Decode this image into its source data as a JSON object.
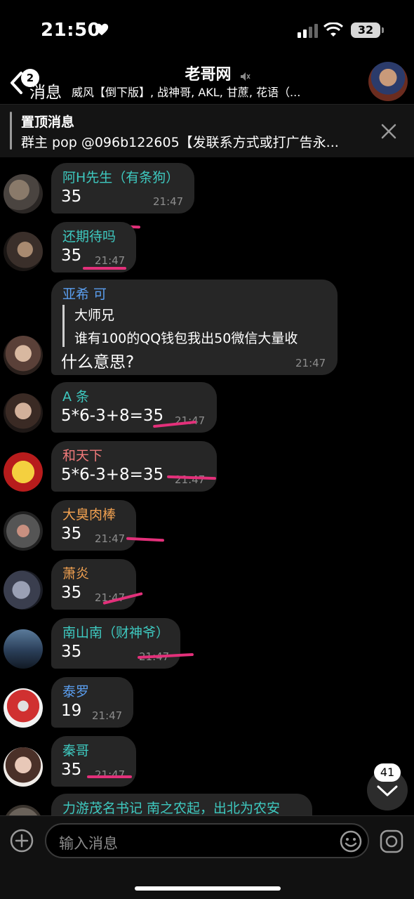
{
  "status_bar": {
    "time": "21:50",
    "battery": "32"
  },
  "header": {
    "back_badge": "2",
    "back_label": "消息",
    "title": "老哥网",
    "subtitle": "威风【倒下版】, 战神哥, AKL, 甘蔗, 花语（..."
  },
  "pinned": {
    "title": "置顶消息",
    "text": "群主 pop @096b122605【发联系方式或打广告永..."
  },
  "messages": [
    {
      "sender": "阿H先生（有条狗）",
      "sender_color": "#3ec9c0",
      "text": "35",
      "time": "21:47"
    },
    {
      "sender": "还期待吗",
      "sender_color": "#3ec9c0",
      "text": "35",
      "time": "21:47"
    },
    {
      "sender": "亚希 可",
      "sender_color": "#5b9ff0",
      "quote_name": "大师兄",
      "quote_text": "谁有100的QQ钱包我出50微信大量收",
      "text": "什么意思?",
      "time": "21:47"
    },
    {
      "sender": "A 条",
      "sender_color": "#3ec9c0",
      "text": "5*6-3+8=35",
      "time": "21:47"
    },
    {
      "sender": "和天下",
      "sender_color": "#f07a7a",
      "text": "5*6-3+8=35",
      "time": "21:47"
    },
    {
      "sender": "大臭肉棒",
      "sender_color": "#f0a050",
      "text": "35",
      "time": "21:47"
    },
    {
      "sender": "萧炎",
      "sender_color": "#f0a050",
      "text": "35",
      "time": "21:47"
    },
    {
      "sender": "南山南（财神爷）",
      "sender_color": "#3ec9c0",
      "text": "35",
      "time": "21:47"
    },
    {
      "sender": "泰罗",
      "sender_color": "#5b9ff0",
      "text": "19",
      "time": "21:47"
    },
    {
      "sender": "秦哥",
      "sender_color": "#3ec9c0",
      "text": "35",
      "time": "21:47"
    },
    {
      "sender": "力游茂名书记 南之农起，出北为农安",
      "sender_color": "#3ec9c0"
    }
  ],
  "unread_count": "41",
  "input": {
    "placeholder": "输入消息"
  }
}
